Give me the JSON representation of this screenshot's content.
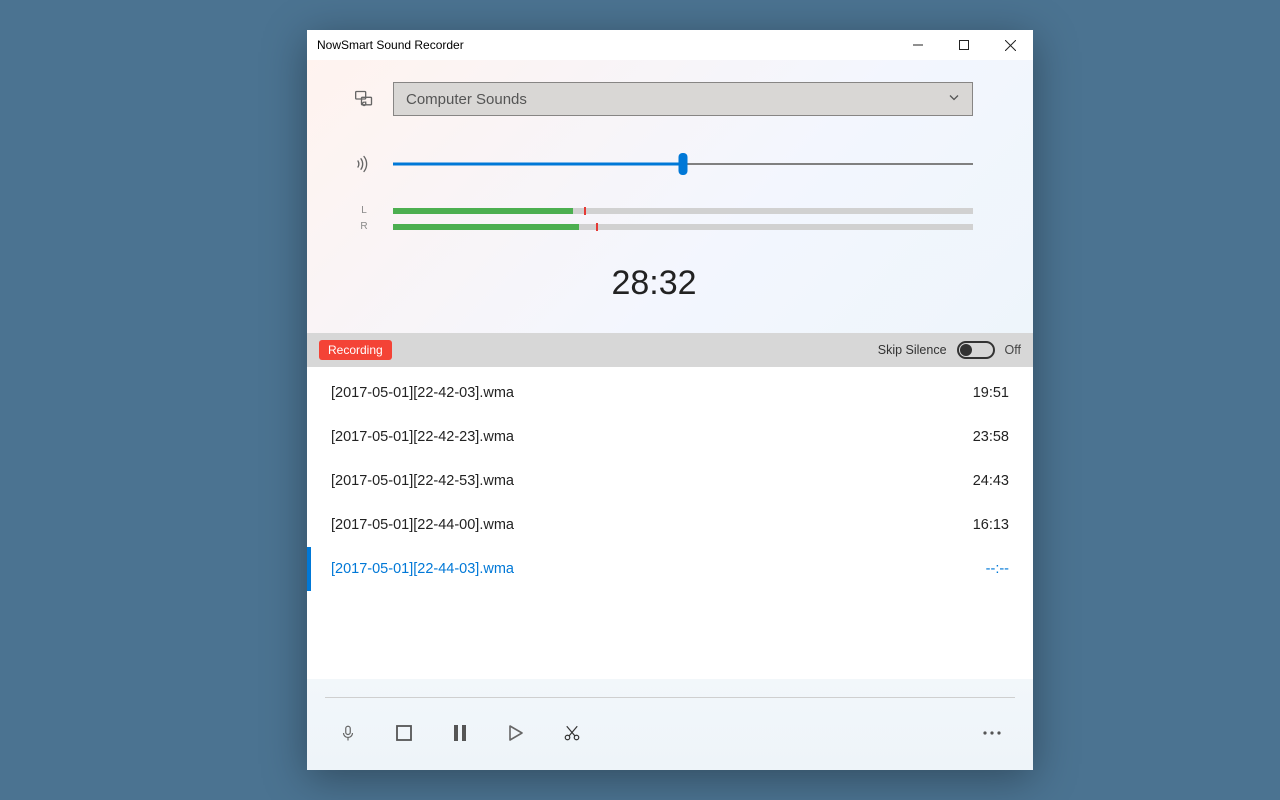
{
  "window": {
    "title": "NowSmart Sound Recorder"
  },
  "source": {
    "selected": "Computer Sounds"
  },
  "volume": {
    "percent": 50
  },
  "levels": {
    "label_left": "L",
    "label_right": "R",
    "left_fill": 31,
    "left_peak": 33,
    "right_fill": 32,
    "right_peak": 35
  },
  "timer": "28:32",
  "status": {
    "badge": "Recording",
    "skip_silence_label": "Skip Silence",
    "skip_silence_state_text": "Off"
  },
  "files": [
    {
      "name": "[2017-05-01][22-42-03].wma",
      "duration": "19:51",
      "active": false
    },
    {
      "name": "[2017-05-01][22-42-23].wma",
      "duration": "23:58",
      "active": false
    },
    {
      "name": "[2017-05-01][22-42-53].wma",
      "duration": "24:43",
      "active": false
    },
    {
      "name": "[2017-05-01][22-44-00].wma",
      "duration": "16:13",
      "active": false
    },
    {
      "name": "[2017-05-01][22-44-03].wma",
      "duration": "--:--",
      "active": true
    }
  ]
}
